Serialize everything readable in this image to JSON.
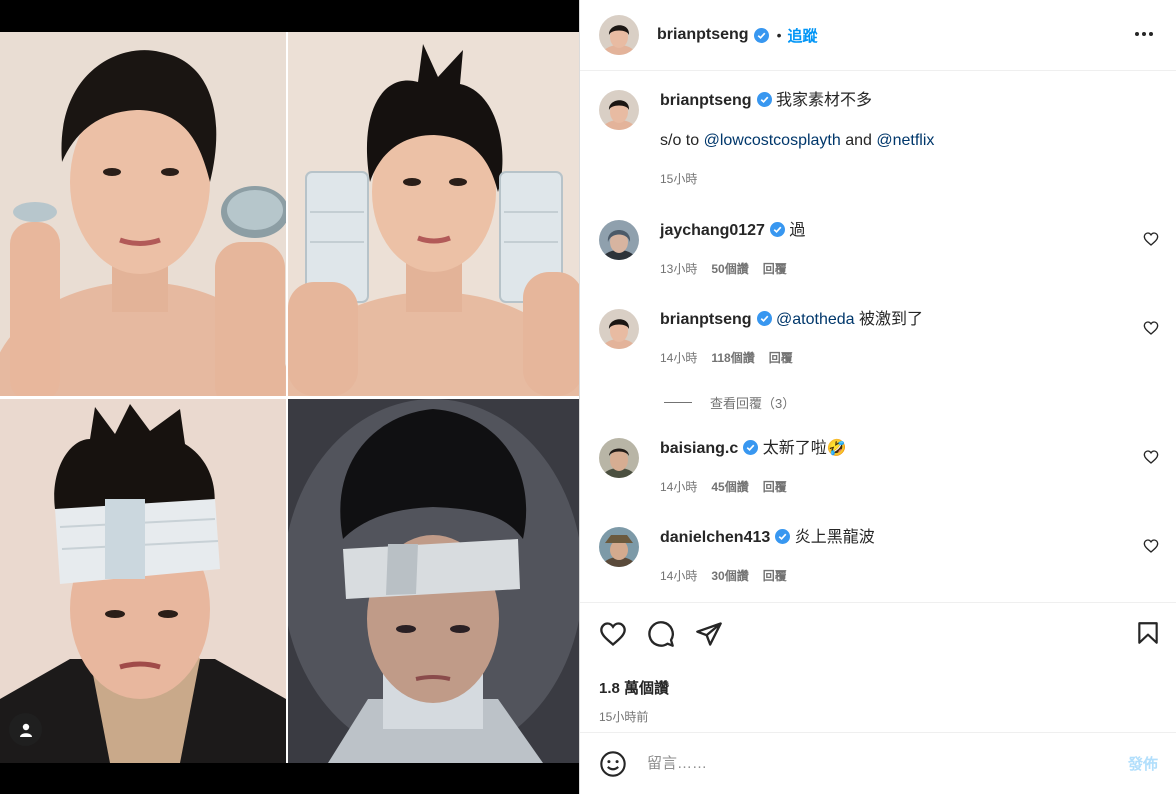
{
  "header": {
    "username": "brianptseng",
    "follow_label": "追蹤"
  },
  "caption": {
    "username": "brianptseng",
    "text": "我家素材不多",
    "line2_prefix": "s/o to ",
    "mention1": "@lowcostcosplayth",
    "line2_and": " and ",
    "mention2": "@netflix",
    "time": "15小時"
  },
  "comments": [
    {
      "username": "jaychang0127",
      "mention": "",
      "text": "過",
      "time": "13小時",
      "likes": "50個讚",
      "reply": "回覆"
    },
    {
      "username": "brianptseng",
      "mention": "@atotheda",
      "text": "被激到了",
      "time": "14小時",
      "likes": "118個讚",
      "reply": "回覆"
    },
    {
      "username": "baisiang.c",
      "mention": "",
      "text": "太新了啦🤣",
      "time": "14小時",
      "likes": "45個讚",
      "reply": "回覆"
    },
    {
      "username": "danielchen413",
      "mention": "",
      "text": "炎上黑龍波",
      "time": "14小時",
      "likes": "30個讚",
      "reply": "回覆"
    }
  ],
  "view_replies_label": "查看回覆（3）",
  "likes_count": "1.8 萬個讚",
  "post_time": "15小時前",
  "composer": {
    "placeholder": "留言……",
    "post_label": "發佈"
  },
  "icons": {
    "more": "more-options-icon",
    "like": "heart-icon",
    "comment": "comment-icon",
    "share": "share-icon",
    "save": "bookmark-icon",
    "emoji": "emoji-icon",
    "tag": "user-tag-icon",
    "verified": "verified-badge-icon"
  },
  "colors": {
    "accent": "#0095f6",
    "verified": "#3897f0",
    "mention": "#00376b",
    "post_disabled": "#b2dffc"
  }
}
